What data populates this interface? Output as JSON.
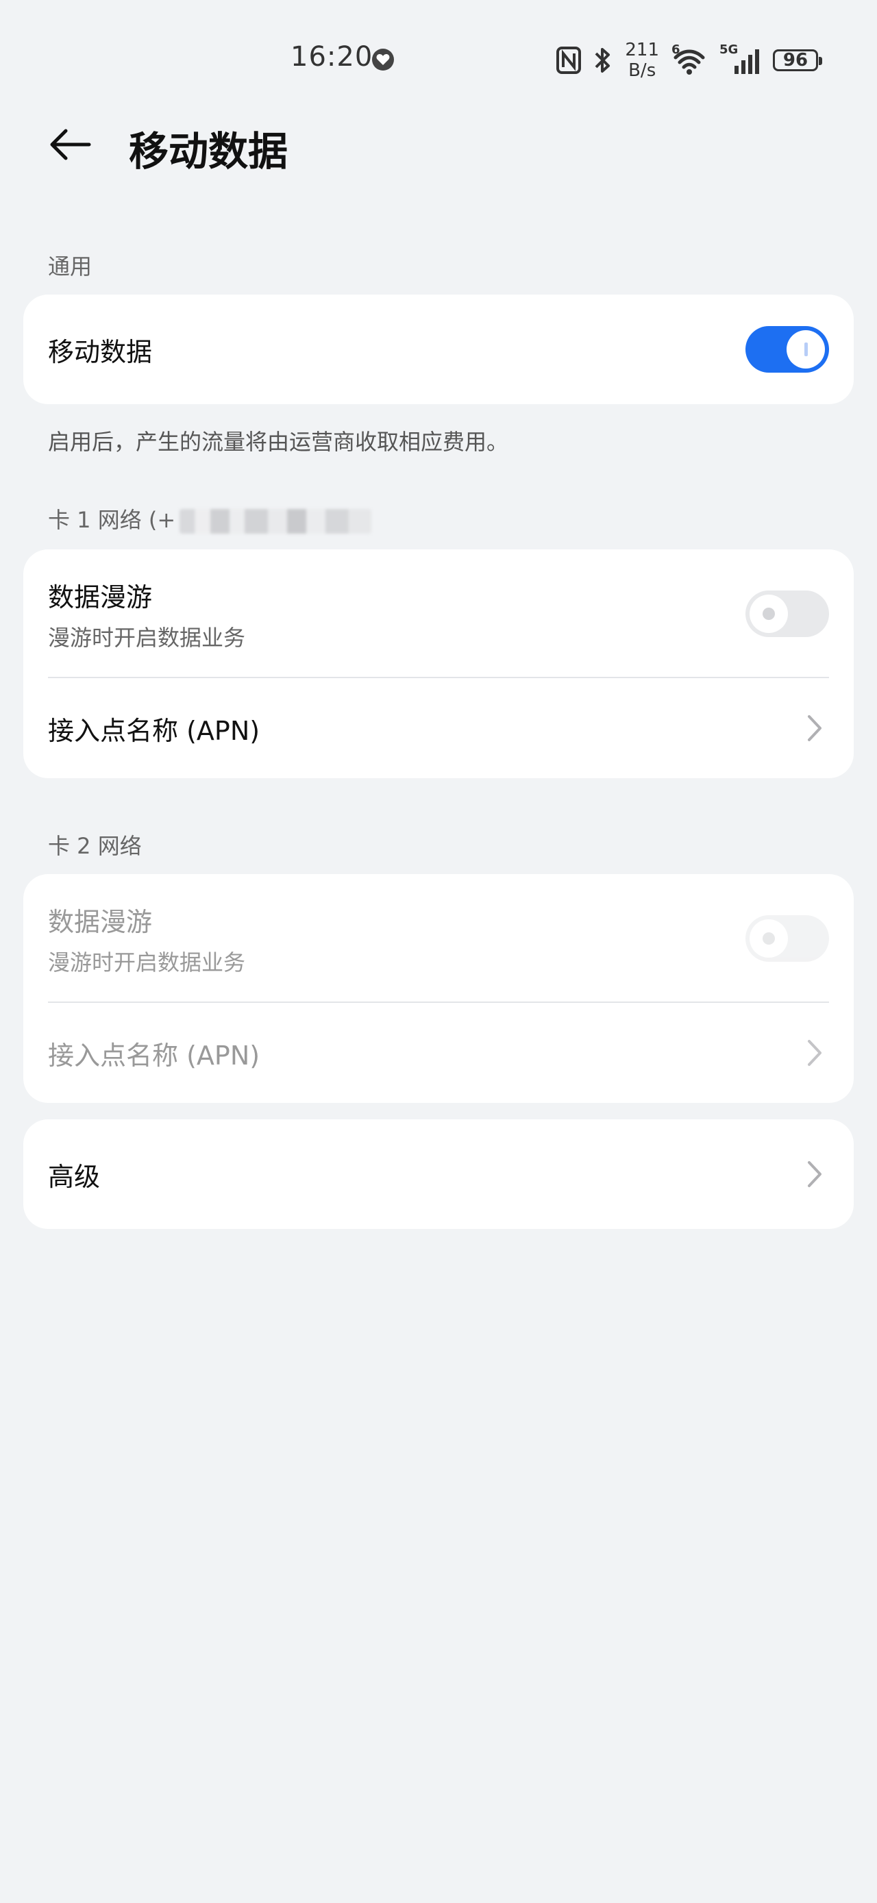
{
  "status_bar": {
    "time": "16:20",
    "net_speed_value": "211",
    "net_speed_unit": "B/s",
    "wifi_label": "6",
    "signal_label": "5G",
    "battery_level": "96"
  },
  "header": {
    "title": "移动数据"
  },
  "general": {
    "section_title": "通用",
    "mobile_data_label": "移动数据",
    "mobile_data_on": true,
    "note": "启用后，产生的流量将由运营商收取相应费用。"
  },
  "sim1": {
    "section_title": "卡 1 网络 (+",
    "roaming_label": "数据漫游",
    "roaming_sub": "漫游时开启数据业务",
    "apn_label": "接入点名称 (APN)"
  },
  "sim2": {
    "section_title": "卡 2 网络",
    "roaming_label": "数据漫游",
    "roaming_sub": "漫游时开启数据业务",
    "apn_label": "接入点名称 (APN)"
  },
  "advanced": {
    "label": "高级"
  },
  "colors": {
    "accent": "#1d6ff2",
    "background": "#f1f3f5",
    "card": "#ffffff"
  }
}
